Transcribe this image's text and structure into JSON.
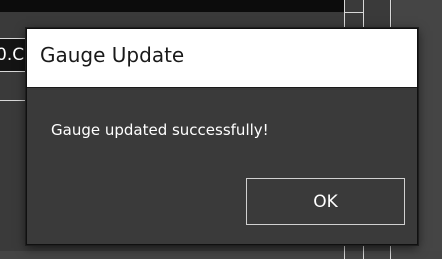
{
  "background": {
    "field_text": "0.C"
  },
  "dialog": {
    "title": "Gauge Update",
    "message": "Gauge updated successfully!",
    "ok_label": "OK"
  },
  "colors": {
    "dialog_bg": "#3a3a3a",
    "titlebar_bg": "#ffffff",
    "title_text": "#1a1a1a",
    "message_text": "#ffffff",
    "button_border": "#d0d0d0"
  }
}
